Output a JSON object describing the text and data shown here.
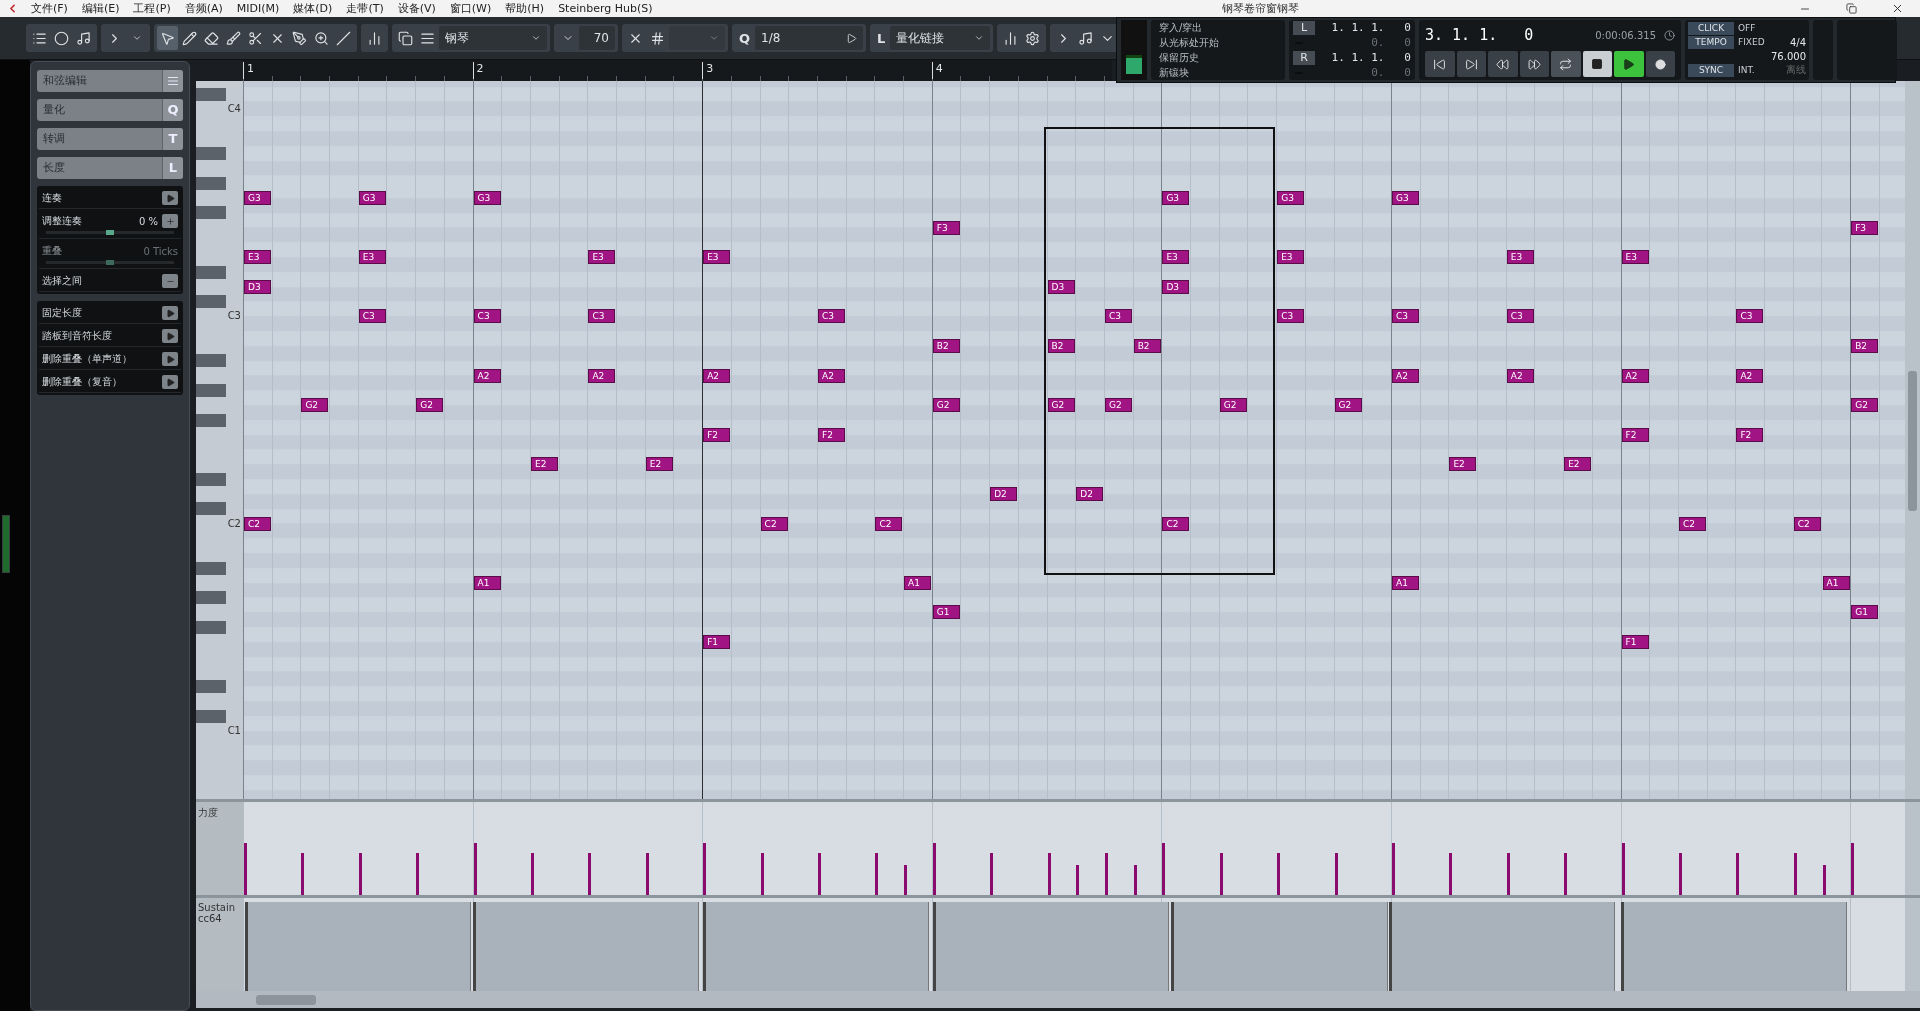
{
  "window": {
    "title": "钢琴卷帘窗钢琴"
  },
  "menu": [
    "文件(F)",
    "编辑(E)",
    "工程(P)",
    "音频(A)",
    "MIDI(M)",
    "媒体(D)",
    "走带(T)",
    "设备(V)",
    "窗口(W)",
    "帮助(H)",
    "Steinberg Hub(S)"
  ],
  "toolbar": {
    "instrument": "钢琴",
    "velocity": "70",
    "quantize_key": "Q",
    "quantize": "1/8",
    "length_key": "L",
    "length_quantize": "量化链接"
  },
  "transport": {
    "punch_items": [
      "穿入/穿出",
      "从光标处开始",
      "保留历史",
      "新镶块"
    ],
    "left_locator": {
      "tag": "L",
      "position": "1. 1. 1.   0",
      "offset": "0.   0"
    },
    "right_locator": {
      "tag": "R",
      "position": "1. 1. 1.   0",
      "offset": "0.   0"
    },
    "position": "3. 1. 1.   0",
    "time": "0:00:06.315",
    "playing": true,
    "click": {
      "tag": "CLICK",
      "value": "OFF"
    },
    "tempo": {
      "tag": "TEMPO",
      "value": "FIXED",
      "signature": "4/4",
      "bpm": "76.000"
    },
    "sync": {
      "tag": "SYNC",
      "value": "INT.",
      "status": "离线"
    }
  },
  "inspector": {
    "sections": [
      {
        "label": "和弦编辑",
        "kind": "icon"
      },
      {
        "label": "量化",
        "kind": "letter",
        "key": "Q"
      },
      {
        "label": "转调",
        "kind": "letter",
        "key": "T"
      },
      {
        "label": "长度",
        "kind": "letter",
        "key": "L"
      }
    ],
    "length_tools": [
      {
        "label": "连奏",
        "kind": "action"
      },
      {
        "label": "调整连奏",
        "kind": "slider",
        "value": "0 %",
        "level": 0.5,
        "disabled": false
      },
      {
        "label": "重叠",
        "kind": "slider",
        "value": "0 Ticks",
        "level": 0.5,
        "disabled": true
      },
      {
        "label": "选择之间",
        "kind": "toggle"
      }
    ],
    "length_actions": [
      "固定长度",
      "踏板到音符长度",
      "删除重叠（单声道）",
      "删除重叠（复音）"
    ]
  },
  "ruler": [
    "1",
    "2",
    "3",
    "4"
  ],
  "keyboard_labels": [
    "C4",
    "C3",
    "C2",
    "C1"
  ],
  "notes": [
    "G3",
    "E3",
    "D3",
    "C2",
    "G2",
    "G3",
    "E3",
    "C3",
    "G2",
    "G3",
    "C3",
    "A2",
    "A1",
    "E2",
    "E3",
    "C3",
    "A2",
    "E2",
    "E3",
    "A2",
    "F2",
    "F1",
    "C2",
    "C3",
    "A2",
    "F2",
    "C2",
    "A1",
    "F3",
    "B2",
    "G2",
    "G1",
    "D2",
    "D3",
    "B2",
    "G2",
    "D2",
    "C3",
    "G2",
    "B2",
    "G3",
    "E3",
    "D3",
    "C2",
    "G2",
    "G3",
    "E3",
    "C3",
    "G2",
    "G3",
    "C3",
    "A2",
    "A1",
    "E2",
    "E3",
    "C3",
    "A2",
    "E2",
    "E3",
    "A2",
    "F2",
    "F1",
    "C2",
    "C3",
    "A2",
    "F2",
    "C2",
    "A1",
    "F3",
    "B2",
    "G2",
    "G1"
  ],
  "lanes": [
    {
      "label": "力度",
      "kind": "velocity"
    },
    {
      "label": "Sustain",
      "sublabel": "cc64",
      "kind": "controller"
    }
  ]
}
